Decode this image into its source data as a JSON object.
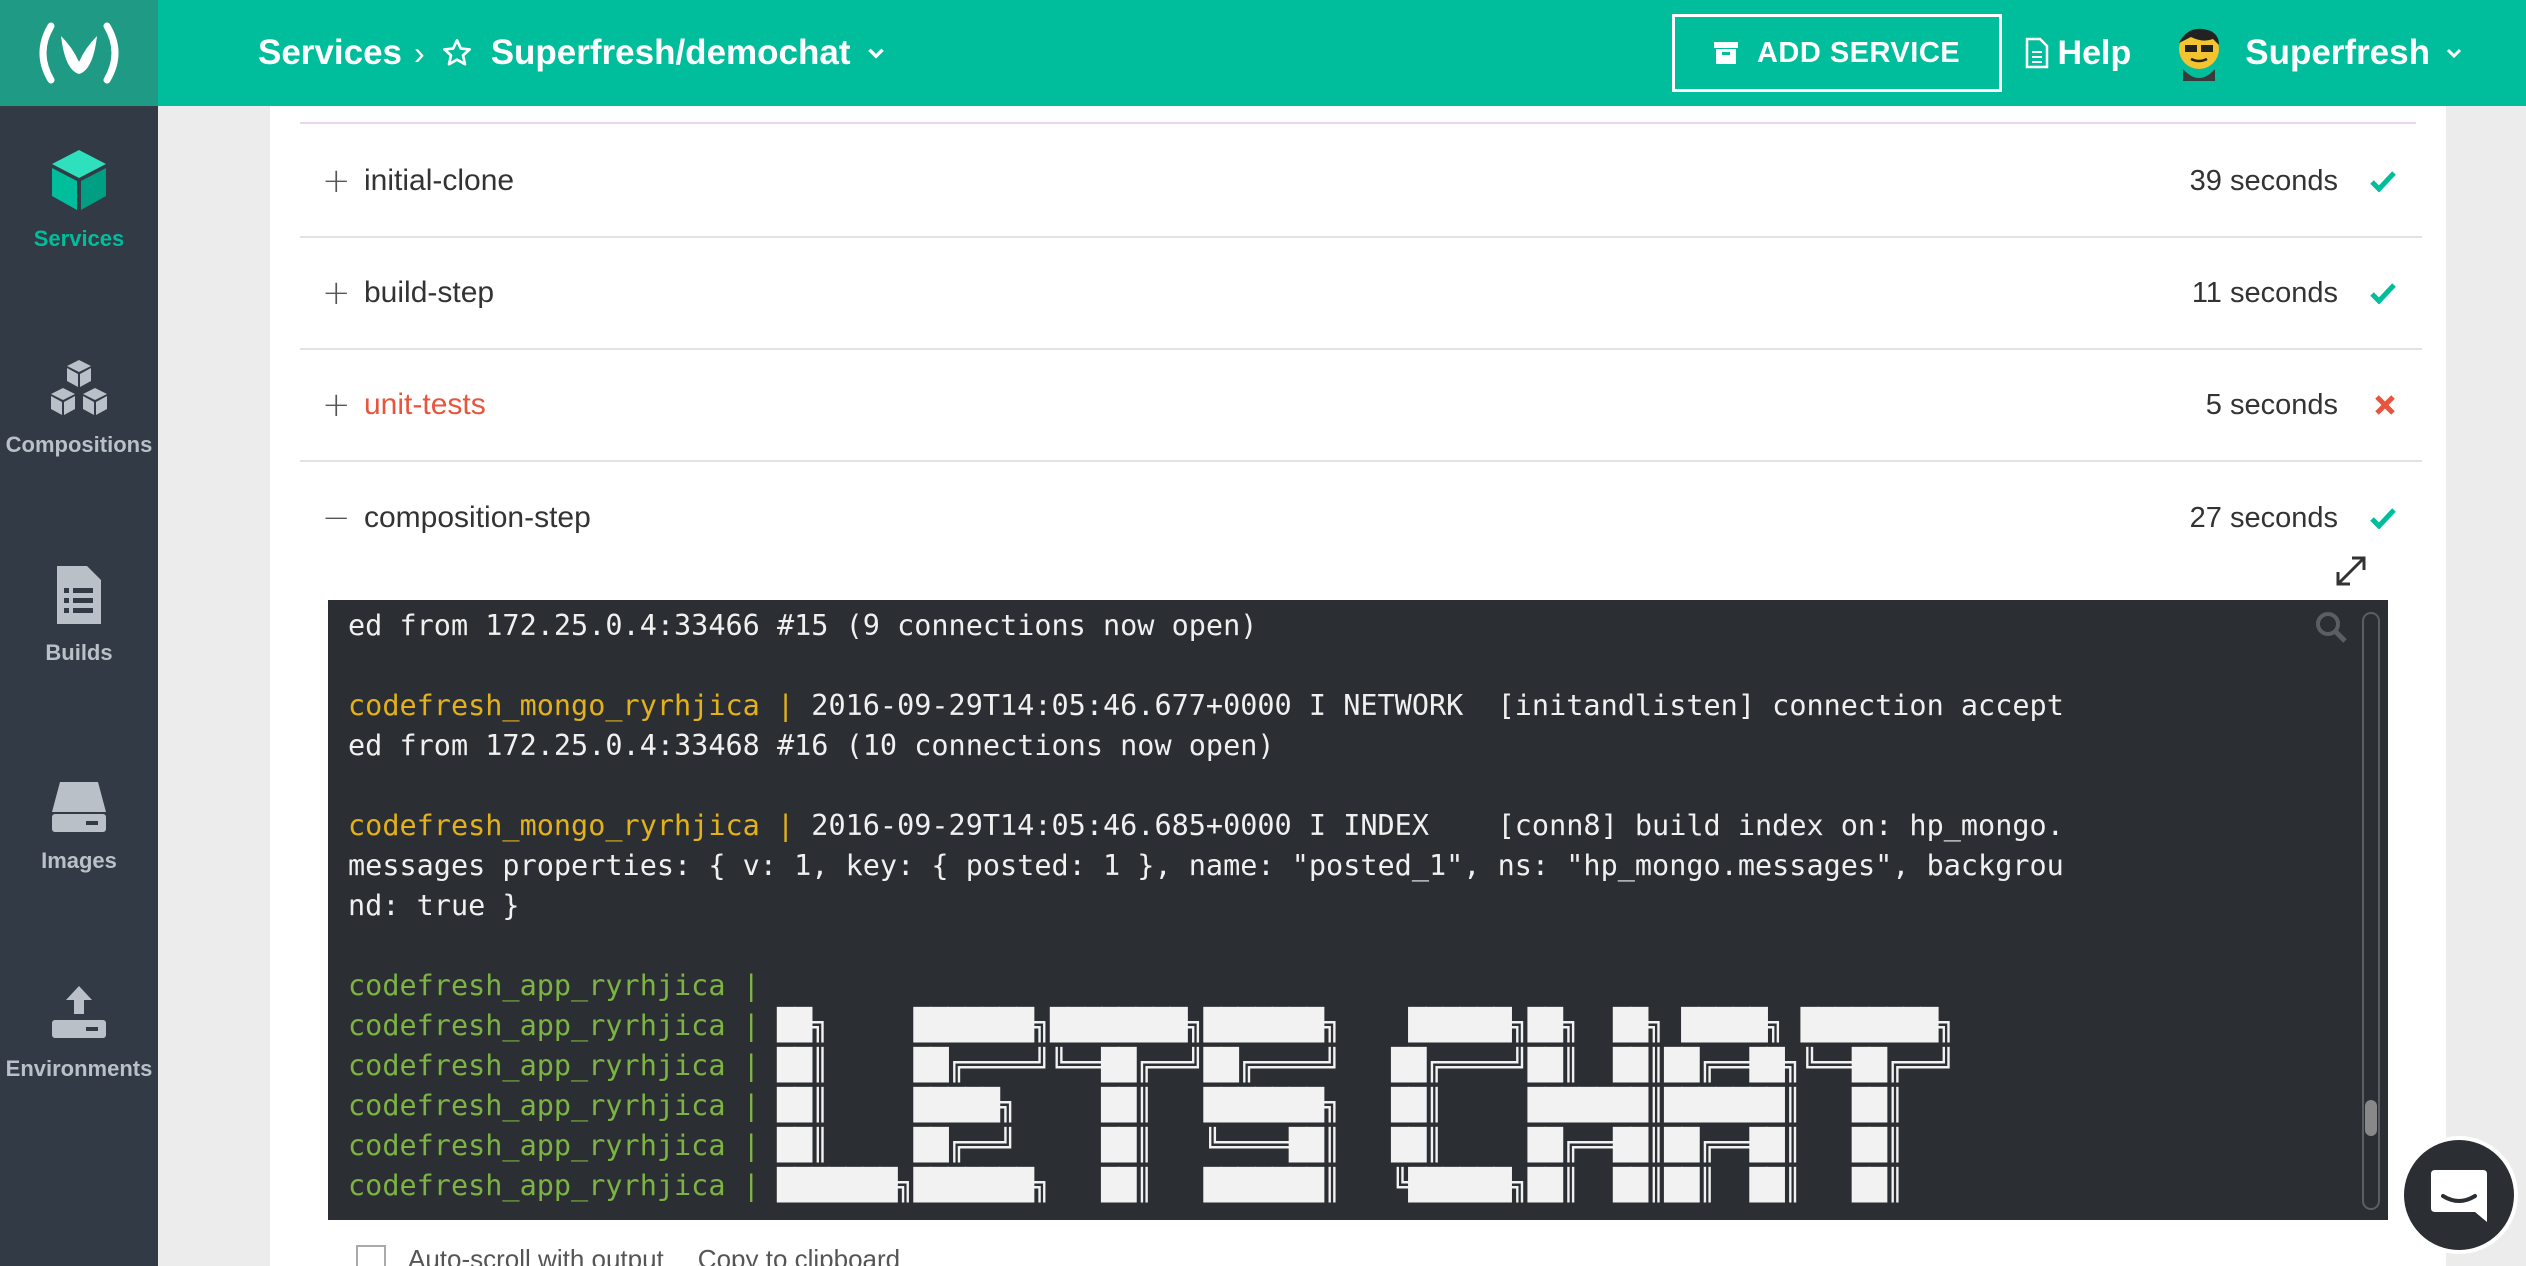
{
  "header": {
    "breadcrumb_root": "Services",
    "breadcrumb_sep": "›",
    "repo": "Superfresh/demochat",
    "add_service_label": "ADD SERVICE",
    "help_label": "Help",
    "user_name": "Superfresh"
  },
  "sidebar": {
    "items": [
      {
        "label": "Services",
        "icon": "cube-icon",
        "active": true
      },
      {
        "label": "Compositions",
        "icon": "cubes-icon",
        "active": false
      },
      {
        "label": "Builds",
        "icon": "document-list-icon",
        "active": false
      },
      {
        "label": "Images",
        "icon": "drive-icon",
        "active": false
      },
      {
        "label": "Environments",
        "icon": "upload-icon",
        "active": false
      }
    ]
  },
  "steps": [
    {
      "name": "initial-clone",
      "duration": "39 seconds",
      "status": "success",
      "toggle": "+"
    },
    {
      "name": "build-step",
      "duration": "11 seconds",
      "status": "success",
      "toggle": "+"
    },
    {
      "name": "unit-tests",
      "duration": "5 seconds",
      "status": "failed",
      "toggle": "+"
    },
    {
      "name": "composition-step",
      "duration": "27 seconds",
      "status": "success",
      "toggle": "−"
    }
  ],
  "terminal": {
    "lines": [
      {
        "prefix": "",
        "text": "ed from 172.25.0.4:33466 #15 (9 connections now open)"
      },
      {
        "prefix": "",
        "text": ""
      },
      {
        "prefix": "codefresh_mongo_ryrhjica | ",
        "text": "2016-09-29T14:05:46.677+0000 I NETWORK  [initandlisten] connection accept"
      },
      {
        "prefix": "",
        "text": "ed from 172.25.0.4:33468 #16 (10 connections now open)"
      },
      {
        "prefix": "",
        "text": ""
      },
      {
        "prefix": "codefresh_mongo_ryrhjica | ",
        "text": "2016-09-29T14:05:46.685+0000 I INDEX    [conn8] build index on: hp_mongo."
      },
      {
        "prefix": "",
        "text": "messages properties: { v: 1, key: { posted: 1 }, name: \"posted_1\", ns: \"hp_mongo.messages\", backgrou"
      },
      {
        "prefix": "",
        "text": "nd: true }"
      },
      {
        "prefix": "",
        "text": ""
      },
      {
        "prefix": "codefresh_app_ryrhjica | ",
        "text": ""
      },
      {
        "prefix": "codefresh_app_ryrhjica | ",
        "text": "██╗     ███████╗████████╗███████╗    ██████╗██╗  ██╗ █████╗ ████████╗"
      },
      {
        "prefix": "codefresh_app_ryrhjica | ",
        "text": "██║     ██╔════╝╚══██╔══╝██╔════╝   ██╔════╝██║  ██║██╔══██╗╚══██╔══╝"
      },
      {
        "prefix": "codefresh_app_ryrhjica | ",
        "text": "██║     █████╗     ██║   ███████╗   ██║     ███████║███████║   ██║"
      },
      {
        "prefix": "codefresh_app_ryrhjica | ",
        "text": "██║     ██╔══╝     ██║   ╚════██║   ██║     ██╔══██║██╔══██║   ██║"
      },
      {
        "prefix": "codefresh_app_ryrhjica | ",
        "text": "███████╗███████╗   ██║   ███████║   ╚██████╗██║  ██║██║  ██║   ██║"
      }
    ]
  },
  "options": {
    "autoscroll_label": "Auto-scroll with output",
    "copy_link_label": "Copy to clipboard"
  }
}
